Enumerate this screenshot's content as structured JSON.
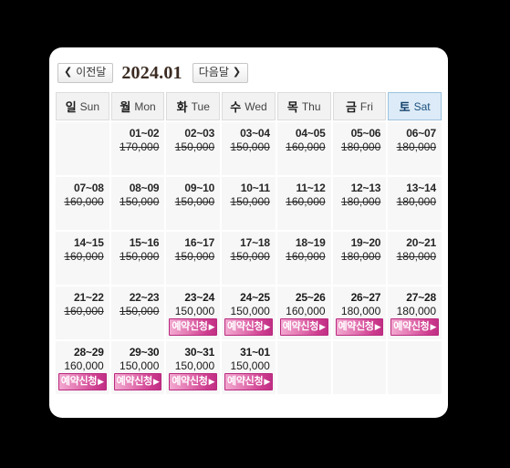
{
  "nav": {
    "prev_label": "이전달",
    "prev_icon": "chevron-left-icon",
    "next_label": "다음달",
    "next_icon": "chevron-right-icon",
    "month_title": "2024.01"
  },
  "colors": {
    "background": "#000000",
    "panel": "#ffffff",
    "cell": "#f7f7f7",
    "day_header": "#f2f2f2",
    "saturday_header": "#dcebf7",
    "saturday_border": "#9cc3de",
    "book_button_light": "#f2a8d0",
    "book_button_dark": "#c02f84",
    "month_title_text": "#3b2b22"
  },
  "day_headers": [
    {
      "ko": "일",
      "en": "Sun",
      "highlight": false
    },
    {
      "ko": "월",
      "en": "Mon",
      "highlight": false
    },
    {
      "ko": "화",
      "en": "Tue",
      "highlight": false
    },
    {
      "ko": "수",
      "en": "Wed",
      "highlight": false
    },
    {
      "ko": "목",
      "en": "Thu",
      "highlight": false
    },
    {
      "ko": "금",
      "en": "Fri",
      "highlight": false
    },
    {
      "ko": "토",
      "en": "Sat",
      "highlight": true
    }
  ],
  "book_button": {
    "label": "예약신청",
    "arrow": "▶"
  },
  "weeks": [
    [
      {
        "empty": true
      },
      {
        "range": "01~02",
        "price": "170,000",
        "sold_out": true,
        "bookable": false
      },
      {
        "range": "02~03",
        "price": "150,000",
        "sold_out": true,
        "bookable": false
      },
      {
        "range": "03~04",
        "price": "150,000",
        "sold_out": true,
        "bookable": false
      },
      {
        "range": "04~05",
        "price": "160,000",
        "sold_out": true,
        "bookable": false
      },
      {
        "range": "05~06",
        "price": "180,000",
        "sold_out": true,
        "bookable": false
      },
      {
        "range": "06~07",
        "price": "180,000",
        "sold_out": true,
        "bookable": false
      }
    ],
    [
      {
        "range": "07~08",
        "price": "160,000",
        "sold_out": true,
        "bookable": false
      },
      {
        "range": "08~09",
        "price": "150,000",
        "sold_out": true,
        "bookable": false
      },
      {
        "range": "09~10",
        "price": "150,000",
        "sold_out": true,
        "bookable": false
      },
      {
        "range": "10~11",
        "price": "150,000",
        "sold_out": true,
        "bookable": false
      },
      {
        "range": "11~12",
        "price": "160,000",
        "sold_out": true,
        "bookable": false
      },
      {
        "range": "12~13",
        "price": "180,000",
        "sold_out": true,
        "bookable": false
      },
      {
        "range": "13~14",
        "price": "180,000",
        "sold_out": true,
        "bookable": false
      }
    ],
    [
      {
        "range": "14~15",
        "price": "160,000",
        "sold_out": true,
        "bookable": false
      },
      {
        "range": "15~16",
        "price": "150,000",
        "sold_out": true,
        "bookable": false
      },
      {
        "range": "16~17",
        "price": "150,000",
        "sold_out": true,
        "bookable": false
      },
      {
        "range": "17~18",
        "price": "150,000",
        "sold_out": true,
        "bookable": false
      },
      {
        "range": "18~19",
        "price": "160,000",
        "sold_out": true,
        "bookable": false
      },
      {
        "range": "19~20",
        "price": "180,000",
        "sold_out": true,
        "bookable": false
      },
      {
        "range": "20~21",
        "price": "180,000",
        "sold_out": true,
        "bookable": false
      }
    ],
    [
      {
        "range": "21~22",
        "price": "160,000",
        "sold_out": true,
        "bookable": false
      },
      {
        "range": "22~23",
        "price": "150,000",
        "sold_out": true,
        "bookable": false
      },
      {
        "range": "23~24",
        "price": "150,000",
        "sold_out": false,
        "bookable": true
      },
      {
        "range": "24~25",
        "price": "150,000",
        "sold_out": false,
        "bookable": true
      },
      {
        "range": "25~26",
        "price": "160,000",
        "sold_out": false,
        "bookable": true
      },
      {
        "range": "26~27",
        "price": "180,000",
        "sold_out": false,
        "bookable": true
      },
      {
        "range": "27~28",
        "price": "180,000",
        "sold_out": false,
        "bookable": true
      }
    ],
    [
      {
        "range": "28~29",
        "price": "160,000",
        "sold_out": false,
        "bookable": true
      },
      {
        "range": "29~30",
        "price": "150,000",
        "sold_out": false,
        "bookable": true
      },
      {
        "range": "30~31",
        "price": "150,000",
        "sold_out": false,
        "bookable": true
      },
      {
        "range": "31~01",
        "price": "150,000",
        "sold_out": false,
        "bookable": true
      },
      {
        "empty": true
      },
      {
        "empty": true
      },
      {
        "empty": true
      }
    ]
  ]
}
